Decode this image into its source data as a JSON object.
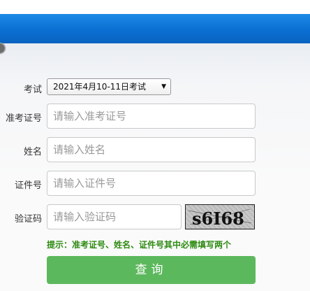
{
  "form": {
    "exam_label": "考试",
    "exam_selected": "2021年4月10-11日考试",
    "ticket_label": "准考证号",
    "ticket_placeholder": "请输入准考证号",
    "name_label": "姓名",
    "name_placeholder": "请输入姓名",
    "id_label": "证件号",
    "id_placeholder": "请输入证件号",
    "captcha_label": "验证码",
    "captcha_placeholder": "请输入验证码",
    "captcha_text": "s6I68",
    "tip": "提示：准考证号、姓名、证件号其中必需填写两个",
    "submit_label": "查询"
  },
  "colors": {
    "header": "#0a6fd2",
    "tip": "#2e8b12",
    "button": "#5cb85c"
  },
  "icons": {
    "select_arrow": "triangle-down"
  }
}
